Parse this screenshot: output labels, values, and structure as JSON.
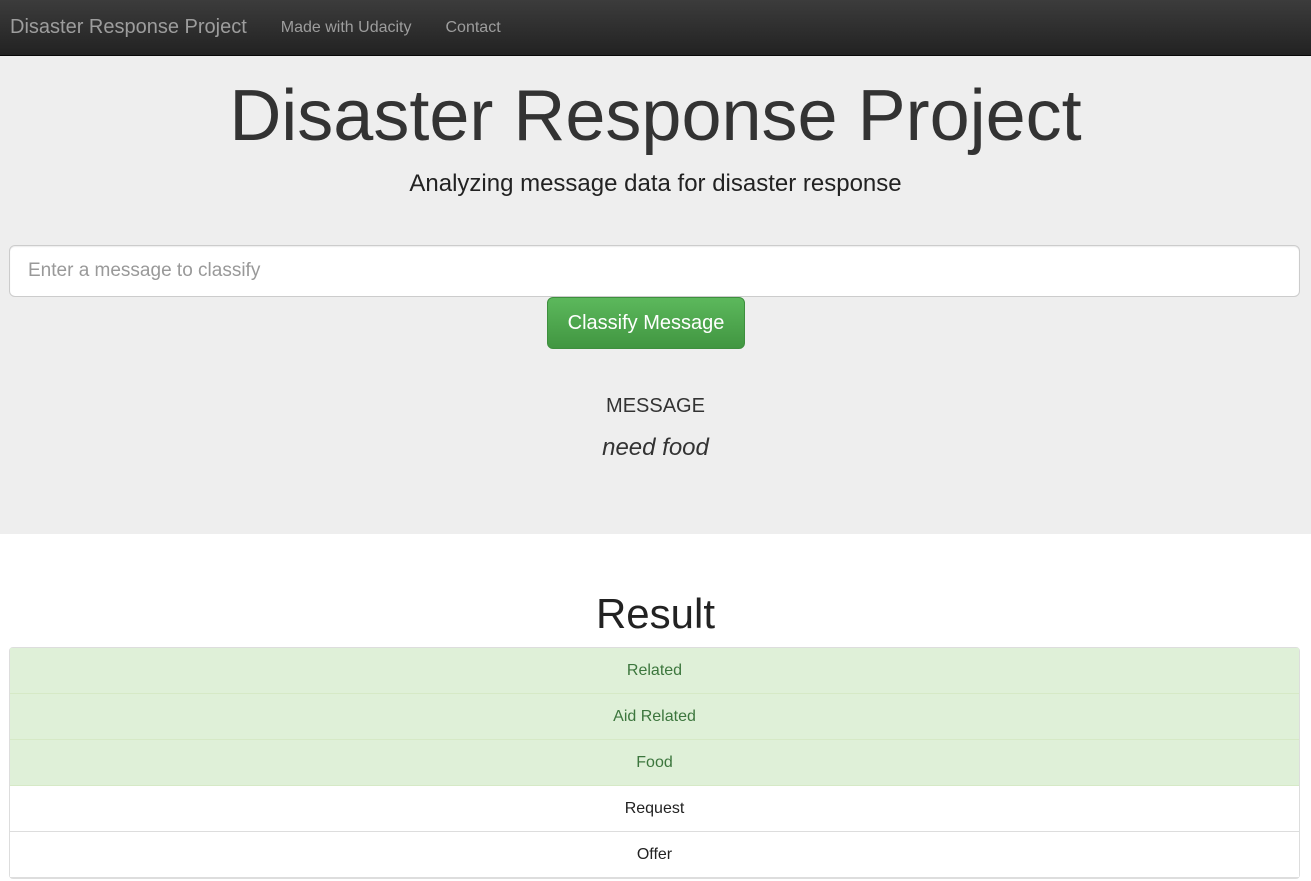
{
  "navbar": {
    "brand": "Disaster Response Project",
    "links": [
      "Made with Udacity",
      "Contact"
    ]
  },
  "header": {
    "title": "Disaster Response Project",
    "subtitle": "Analyzing message data for disaster response"
  },
  "form": {
    "placeholder": "Enter a message to classify",
    "button_label": "Classify Message"
  },
  "message": {
    "label": "MESSAGE",
    "text": "need food"
  },
  "result": {
    "title": "Result",
    "categories": [
      {
        "label": "Related",
        "active": true
      },
      {
        "label": "Aid Related",
        "active": true
      },
      {
        "label": "Food",
        "active": true
      },
      {
        "label": "Request",
        "active": false
      },
      {
        "label": "Offer",
        "active": false
      }
    ]
  },
  "colors": {
    "active_bg": "#dff0d8",
    "active_text": "#3c763d",
    "button_green": "#5cb85c"
  }
}
